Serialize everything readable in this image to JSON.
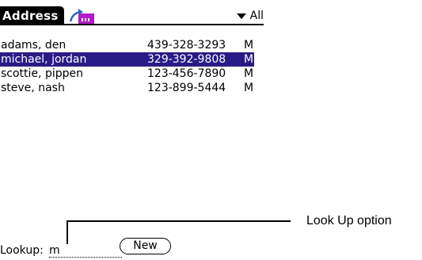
{
  "app": {
    "title": "Address",
    "category": "All",
    "icons": [
      "beam-icon",
      "dropdown-triangle-icon"
    ],
    "accent_color": "#2a1b86"
  },
  "contacts": [
    {
      "name": "adams, den",
      "phone": "439-328-3293",
      "type": "M",
      "selected": false
    },
    {
      "name": "michael, jordan",
      "phone": "329-392-9808",
      "type": "M",
      "selected": true
    },
    {
      "name": "scottie, pippen",
      "phone": "123-456-7890",
      "type": "M",
      "selected": false
    },
    {
      "name": "steve, nash",
      "phone": "123-899-5444",
      "type": "M",
      "selected": false
    }
  ],
  "lookup": {
    "label": "Lookup:",
    "value": "m"
  },
  "new_button": "New",
  "annotation": "Look Up option"
}
